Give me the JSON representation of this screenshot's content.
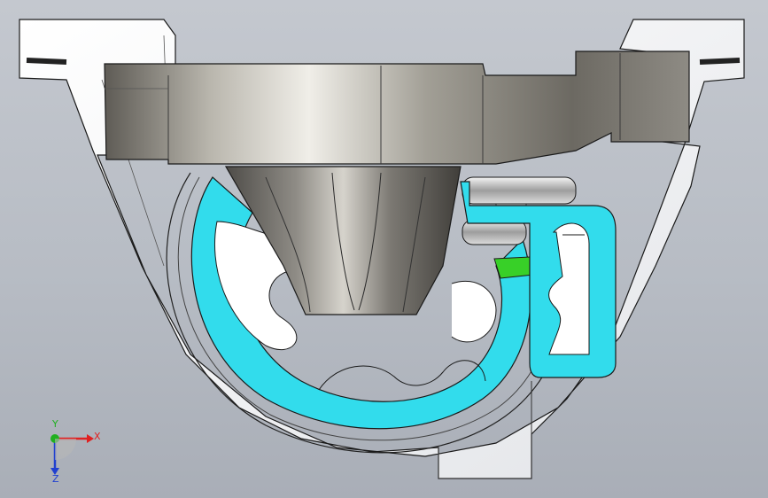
{
  "viewport": {
    "background_top": "#c4c8cf",
    "background_bottom": "#a9aeb7"
  },
  "model": {
    "colors": {
      "bracket": "#f3f4f6",
      "rubber_section": "#32dcec",
      "metal": "#9a9890",
      "nut": "#38d028"
    }
  },
  "triad": {
    "x_label": "X",
    "y_label": "Y",
    "z_label": "Z",
    "x_color": "#e02020",
    "y_color": "#20b020",
    "z_color": "#2040d0"
  }
}
